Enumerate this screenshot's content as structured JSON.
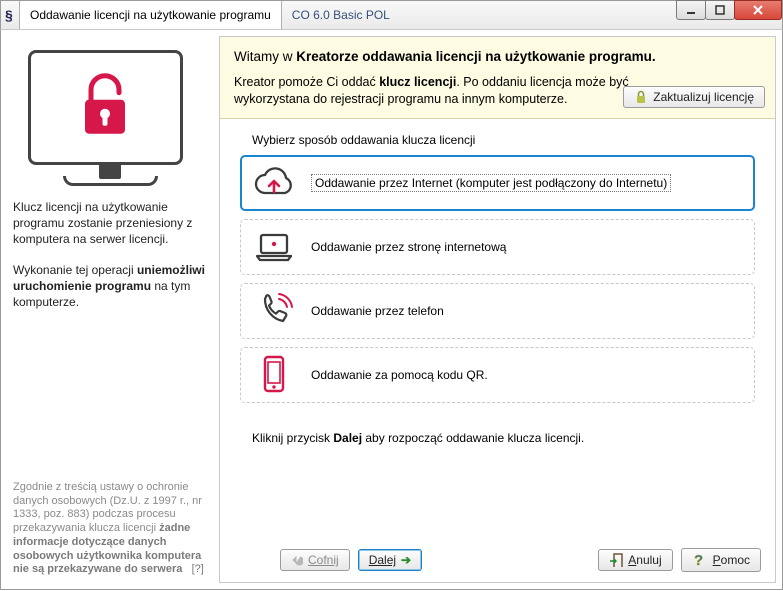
{
  "window": {
    "title_tab": "Oddawanie licencji na użytkowanie programu",
    "app_name": "CO 6.0 Basic POL"
  },
  "banner": {
    "heading_prefix": "Witamy w ",
    "heading_strong": "Kreatorze oddawania licencji na użytkowanie programu.",
    "body_1": "Kreator pomoże Ci oddać ",
    "body_strong": "klucz licencji",
    "body_2": ". Po oddaniu licencja może być wykorzystana do rejestracji programu na innym komputerze.",
    "update_btn": "Zaktualizuj licencję"
  },
  "left": {
    "p1": "Klucz licencji na użytkowanie programu zostanie przeniesiony z komputera na serwer licencji.",
    "p2_a": "Wykonanie tej operacji ",
    "p2_b": "uniemożliwi uruchomienie programu",
    "p2_c": " na tym komputerze.",
    "disclaimer_a": "Zgodnie z treścią ustawy o ochronie danych osobowych (Dz.U. z 1997 r., nr 1333, poz. 883) podczas procesu przekazywania klucza licencji ",
    "disclaimer_b": "żadne informacje dotyczące danych osobowych użytkownika komputera nie są przekazywane do serwera",
    "disclaimer_q": "[?]"
  },
  "main": {
    "section_label": "Wybierz sposób oddawania klucza licencji",
    "options": {
      "internet": "Oddawanie przez Internet (komputer jest podłączony do Internetu)",
      "web": "Oddawanie przez stronę internetową",
      "phone": "Oddawanie przez telefon",
      "qr": "Oddawanie za pomocą kodu QR."
    },
    "instruction_a": "Kliknij przycisk ",
    "instruction_b": "Dalej",
    "instruction_c": " aby rozpocząć oddawanie klucza licencji."
  },
  "footer": {
    "back": "Cofnij",
    "next": "Dalej",
    "cancel": "Anuluj",
    "help": "Pomoc"
  },
  "colors": {
    "accent": "#d6174a",
    "win_blue": "#1a84cf"
  }
}
